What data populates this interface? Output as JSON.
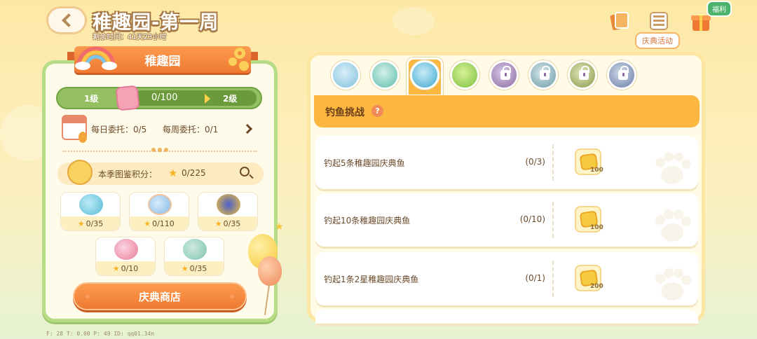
{
  "header": {
    "title": "稚趣园-第一周",
    "subtitle": "剩余时间：41天23小时",
    "festival_label": "庆典活动",
    "welfare_tag": "福利"
  },
  "left": {
    "banner_title": "稚趣园",
    "level": {
      "current": "1级",
      "next": "2级",
      "progress_text": "0/100",
      "progress_fraction": 0.0
    },
    "daily_commission": "每日委托：0/5",
    "weekly_commission": "每周委托：0/1",
    "collection_label": "本季图鉴积分：",
    "collection_value": "0/225",
    "cards": [
      {
        "icon": "fish-icon",
        "value": "0/35"
      },
      {
        "icon": "shell-icon",
        "value": "0/110"
      },
      {
        "icon": "butterfly-icon",
        "value": "0/35"
      },
      {
        "icon": "watering-can-icon",
        "value": "0/10"
      },
      {
        "icon": "bird-icon",
        "value": "0/35"
      }
    ],
    "shop_button": "庆典商店"
  },
  "right": {
    "tabs": [
      {
        "icon": "pot-icon",
        "locked": false
      },
      {
        "icon": "kettle-icon",
        "locked": false
      },
      {
        "icon": "fish-icon",
        "locked": false,
        "active": true
      },
      {
        "icon": "clover-icon",
        "locked": false
      },
      {
        "icon": "lock-icon",
        "locked": true
      },
      {
        "icon": "lock-icon",
        "locked": true
      },
      {
        "icon": "lock-icon",
        "locked": true
      },
      {
        "icon": "lock-icon",
        "locked": true
      }
    ],
    "section_title": "钓鱼挑战",
    "tasks": [
      {
        "name": "钓起5条稚趣园庆典鱼",
        "progress": "(0/3)",
        "reward": "100"
      },
      {
        "name": "钓起10条稚趣园庆典鱼",
        "progress": "(0/10)",
        "reward": "100"
      },
      {
        "name": "钓起1条2星稚趣园庆典鱼",
        "progress": "(0/1)",
        "reward": "200"
      }
    ]
  },
  "debug": "F: 28   T: 0.00   P: 49   ID: qq01.34n",
  "colors": {
    "accent": "#f07a32",
    "panel_border": "#b7dc86",
    "section": "#fbb740"
  }
}
